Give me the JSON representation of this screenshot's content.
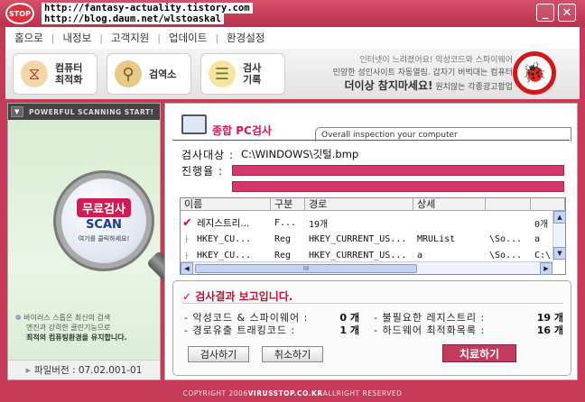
{
  "titlebar": {
    "logo_text": "STOP",
    "urls": [
      "http://fantasy-actuality.tistory.com",
      "http://blog.daum.net/wlstoaskal"
    ],
    "minimize_glyph": "_",
    "close_glyph": "✕"
  },
  "menu": {
    "items": [
      "홈으로",
      "내정보",
      "고객지원",
      "업데이트",
      "환경설정"
    ],
    "separator": "|"
  },
  "toolbar": {
    "tools": [
      {
        "label": "컴퓨터\n최적화",
        "icon": "magnet-icon"
      },
      {
        "label": "검역소",
        "icon": "mortar-icon"
      },
      {
        "label": "검사\n기록",
        "icon": "history-icon"
      }
    ],
    "ad": {
      "line1": "인터넷이 느려졌어요! 악성코드와 스파이웨어",
      "line2": "민망한 성인사이트 자동열림. 갑자기 버벅대는 컴퓨터",
      "line3_strong": "더이상 참지마세요!",
      "line3_rest": " 원치않는 각종광고팝업"
    },
    "nobug_icon": "no-bug-icon"
  },
  "left_panel": {
    "header": "POWERFUL SCANNING START!",
    "toggle": "▼",
    "free_scan": "무료검사",
    "scan_word": "SCAN",
    "scan_click": "여기를 클릭하세요!",
    "desc_line1": "바이러스 스톱은 최신의 검색",
    "desc_line2": "엔진과 강력한 클린기능으로",
    "desc_line3": "최적의 컴퓨팅환경을 유지합니다.",
    "version_label": "파일버전 : 07.02.001-01"
  },
  "main_panel": {
    "title": "종합 PC검사",
    "subtitle": "Overall inspection your computer",
    "target_label": "검사대상 :",
    "target_value": "C:\\WINDOWS\\깃털.bmp",
    "progress_label": "진행율 :",
    "progress_percent": 100,
    "table": {
      "columns": [
        "이름",
        "구분",
        "경로",
        "상세",
        "",
        ""
      ],
      "rows": [
        {
          "checked": true,
          "name": "레지스트리...",
          "type": "F...",
          "path": "19개",
          "detail": "",
          "extra": "",
          "extra2": "0개"
        },
        {
          "checked": false,
          "name": "HKEY_CU...",
          "type": "Reg",
          "path": "HKEY_CURRENT_US...",
          "detail": "MRUList",
          "extra": "\\So...",
          "extra2": "a"
        },
        {
          "checked": false,
          "name": "HKEY_CU...",
          "type": "Reg",
          "path": "HKEY_CURRENT_US...",
          "detail": "a",
          "extra": "\\So...",
          "extra2": "C:\\"
        }
      ],
      "thumb_grip": "III"
    },
    "result": {
      "title": "검사결과 보고입니다.",
      "items": [
        {
          "label": "- 악성코드 & 스파이웨어 :",
          "value": "0 개"
        },
        {
          "label": "- 경로유출 트래킹코드 :",
          "value": "1 개"
        },
        {
          "label": "- 불필요한 레지스트리 :",
          "value": "19 개"
        },
        {
          "label": "- 하드웨어 최적화목록 :",
          "value": "16 개"
        }
      ],
      "buttons": {
        "scan": "검사하기",
        "cancel": "취소하기",
        "treat": "치료하기"
      }
    }
  },
  "footer": {
    "prefix": "COPYRIGHT 2006 ",
    "brand": "VIRUSSTOP.CO.KR",
    "suffix": " ALLRIGHT RESERVED"
  },
  "colors": {
    "accent": "#c73a57",
    "progress": "#d4386b",
    "title_red": "#d8155e"
  }
}
